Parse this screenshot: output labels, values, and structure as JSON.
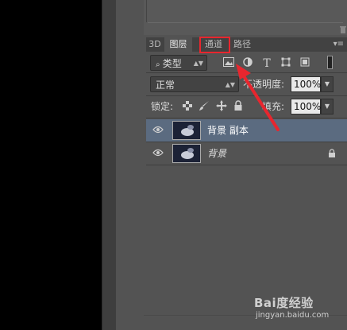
{
  "tabs": [
    {
      "label": "3D"
    },
    {
      "label": "图层"
    },
    {
      "label": "通道"
    },
    {
      "label": "路径"
    }
  ],
  "filter": {
    "kind_label": "类型"
  },
  "blend": {
    "mode": "正常",
    "opacity_label": "不透明度:",
    "opacity_value": "100%"
  },
  "lock": {
    "label": "锁定:",
    "fill_label": "填充:",
    "fill_value": "100%"
  },
  "layers": [
    {
      "name": "背景 副本",
      "selected": true
    },
    {
      "name": "背景",
      "locked": true
    }
  ],
  "colors": {
    "annotation_red": "#e8262e",
    "selected_row": "#5b6b80",
    "panel_bg": "#535353"
  },
  "watermark": {
    "logo": "Bai度经验",
    "url": "jingyan.baidu.com"
  }
}
